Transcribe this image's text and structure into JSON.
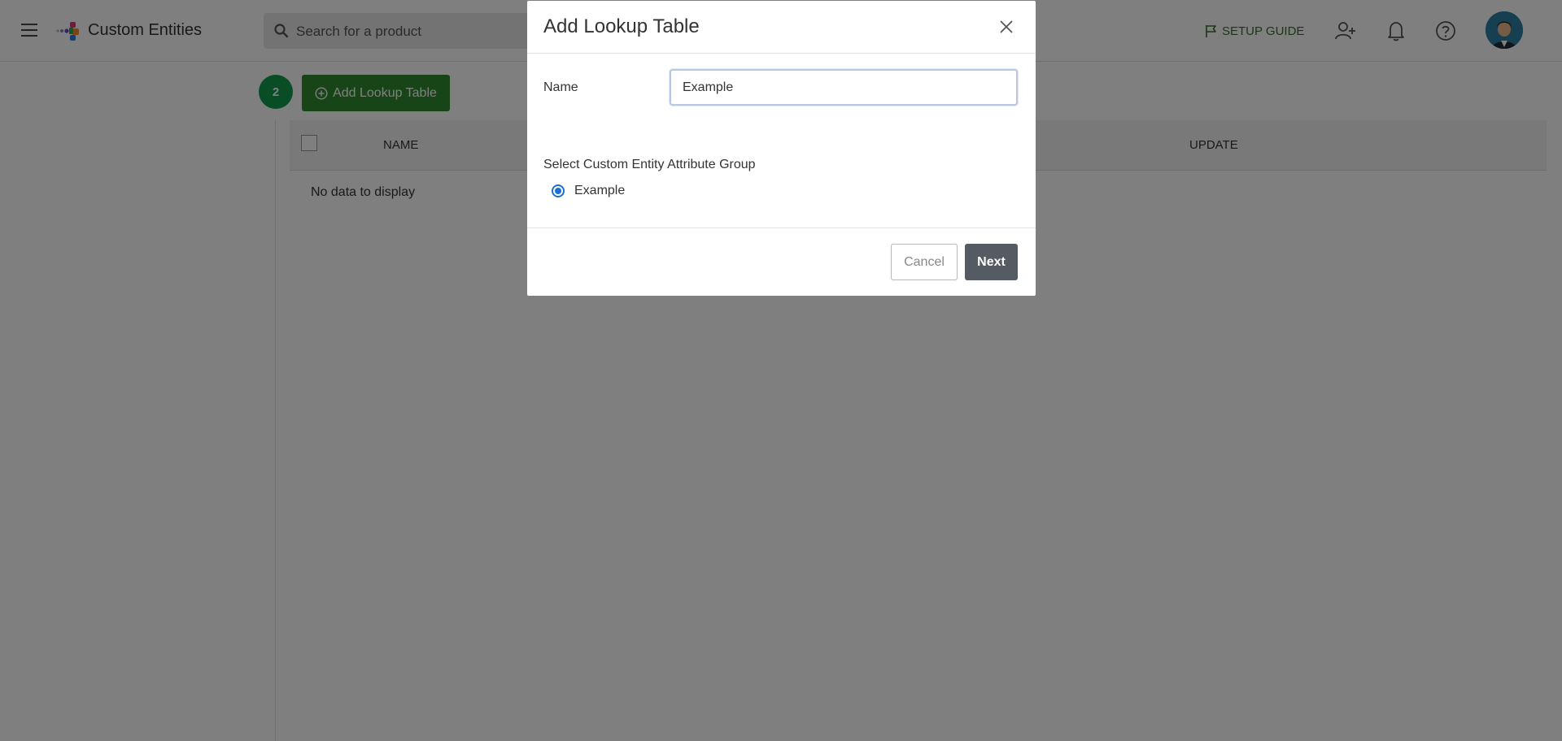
{
  "header": {
    "app_title": "Custom Entities",
    "search_placeholder": "Search for a product",
    "setup_guide_label": "SETUP GUIDE",
    "accent_color": "#3a6d2e"
  },
  "main": {
    "step_number": "2",
    "add_button_label": "Add Lookup Table",
    "table": {
      "columns": [
        "NAME",
        "UPDATE"
      ],
      "rows": [],
      "empty_text": "No data to display"
    }
  },
  "modal": {
    "title": "Add Lookup Table",
    "name_label": "Name",
    "name_value": "Example",
    "group_label": "Select Custom Entity Attribute Group",
    "group_options": [
      {
        "label": "Example",
        "selected": true
      }
    ],
    "cancel_label": "Cancel",
    "next_label": "Next"
  },
  "icons": {
    "menu": "hamburger-icon",
    "logo": "logo-icon",
    "search": "search-icon",
    "setup_guide": "flag-icon",
    "add_user": "add-user-icon",
    "notifications": "bell-icon",
    "help": "help-icon",
    "close": "close-icon",
    "add": "plus-circle-icon"
  }
}
